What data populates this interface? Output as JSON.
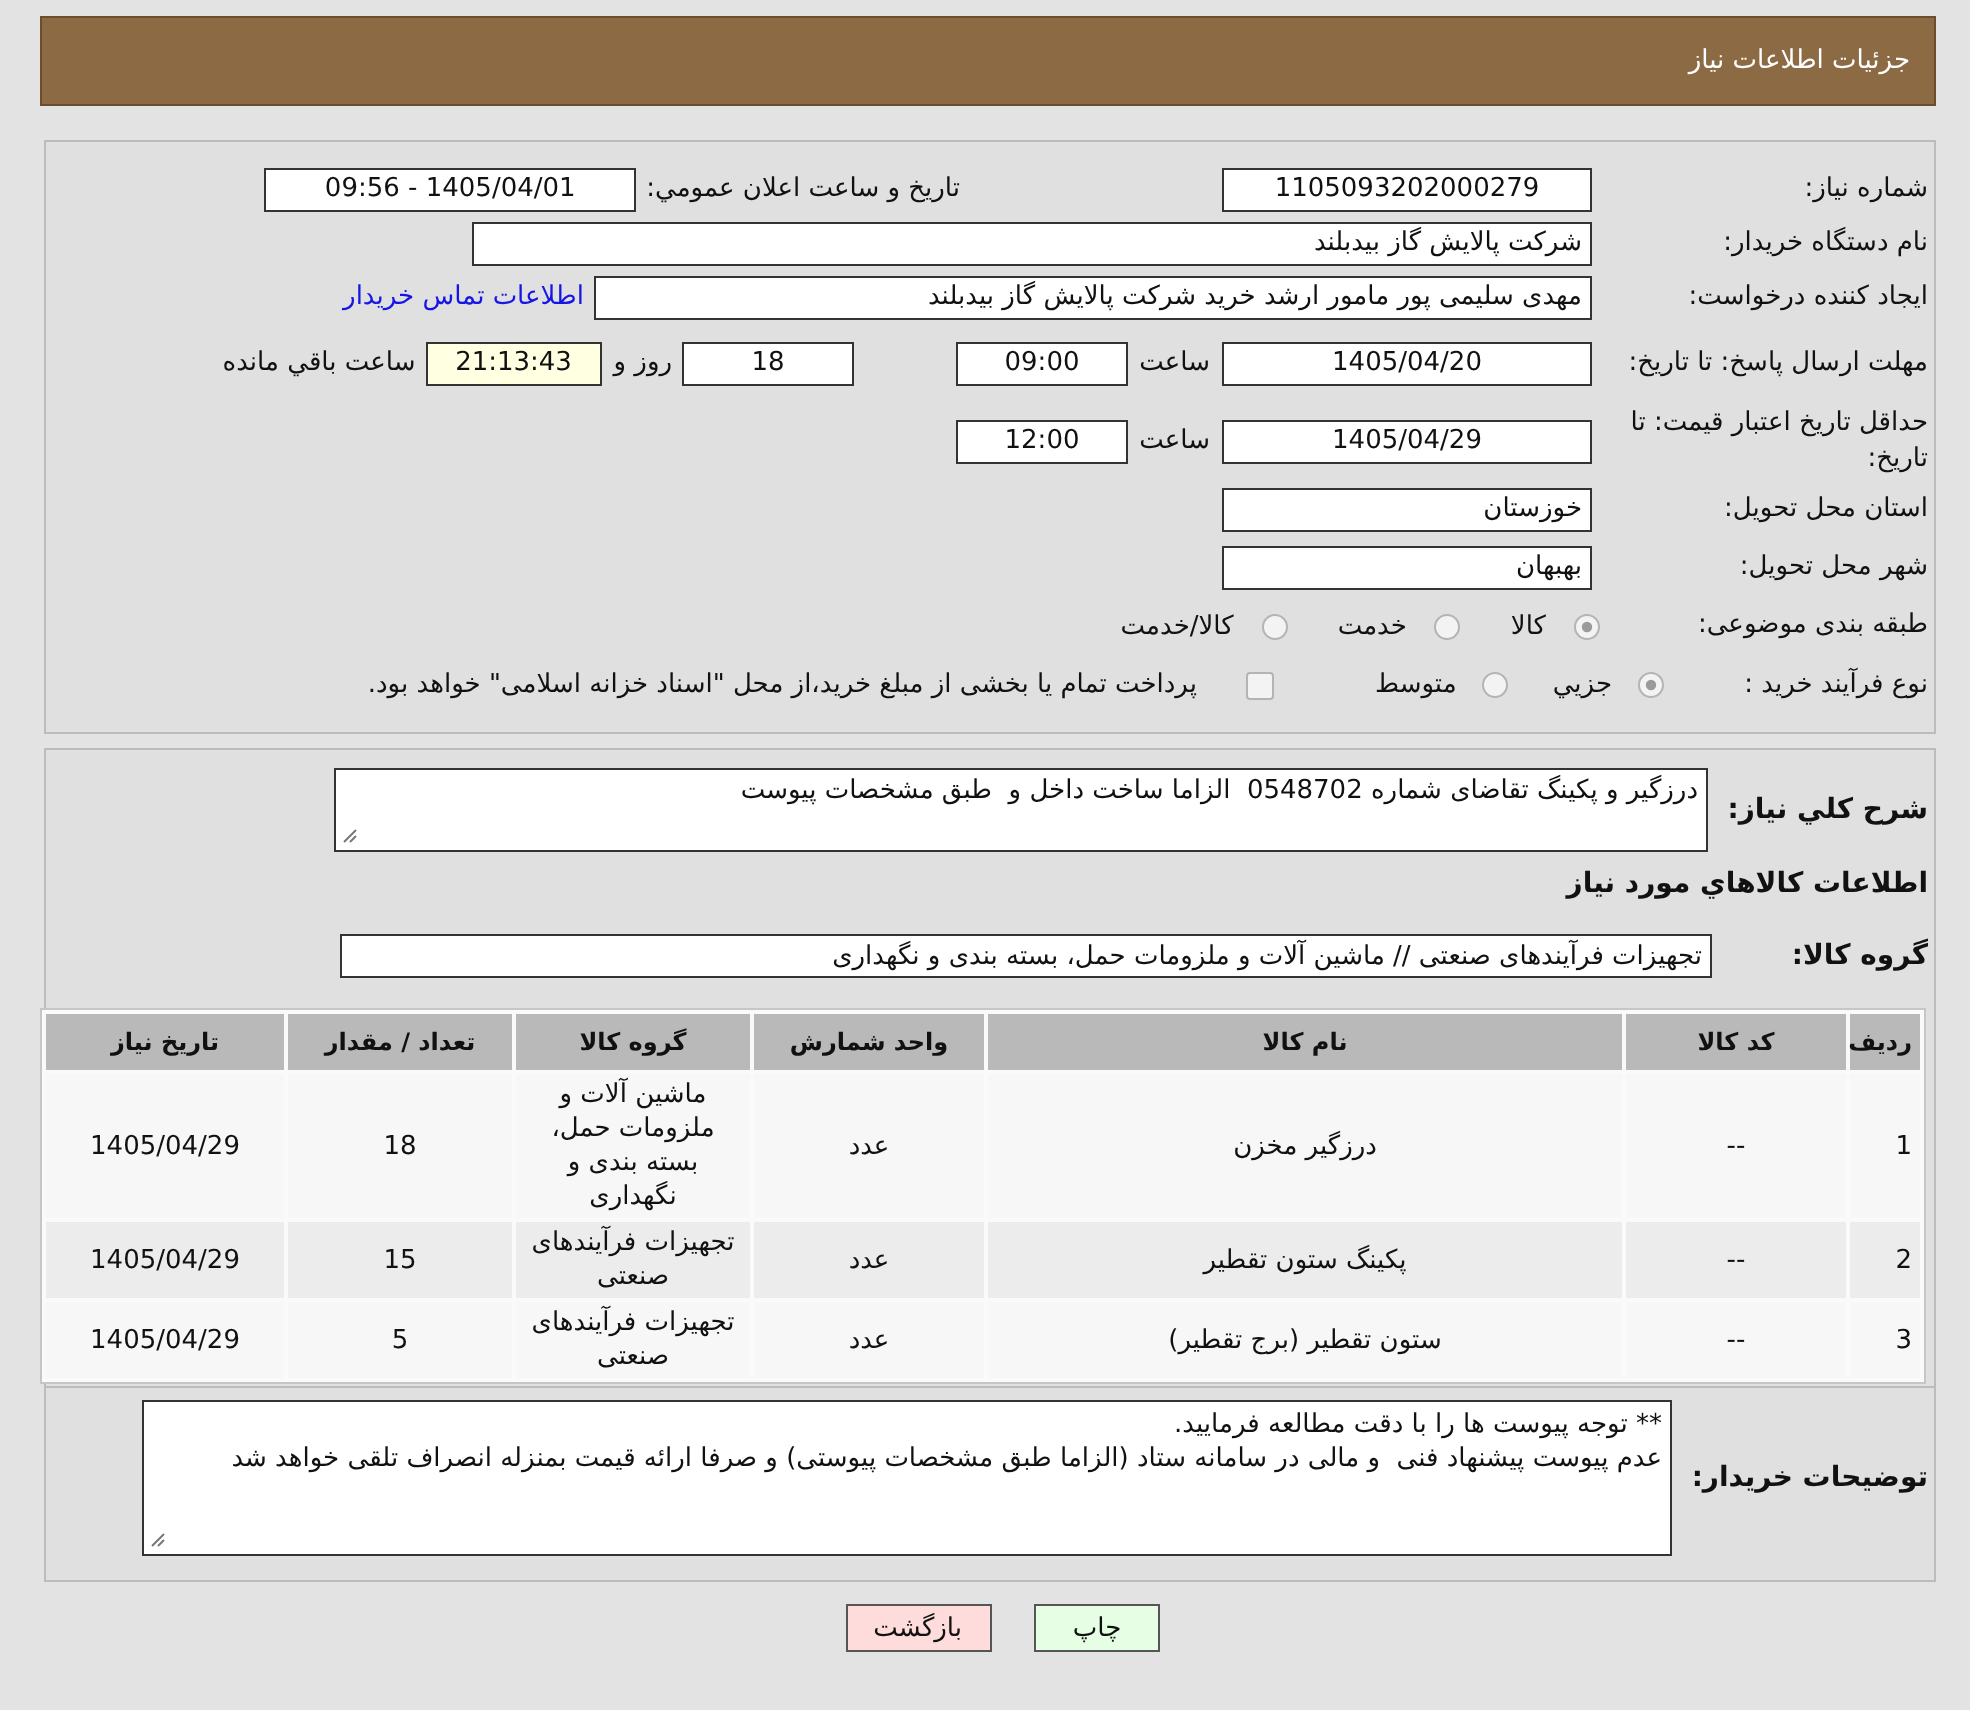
{
  "header": {
    "title": "جزئیات اطلاعات نیاز"
  },
  "details": {
    "need_number": {
      "label": "شماره نیاز:",
      "value": "1105093202000279"
    },
    "announce_date": {
      "label": "تاریخ و ساعت اعلان عمومي:",
      "value": "1405/04/01 - 09:56"
    },
    "buyer_org": {
      "label": "نام دستگاه خريدار:",
      "value": "شرکت پالایش گاز بیدبلند"
    },
    "requester": {
      "label": "ایجاد کننده درخواست:",
      "value": "مهدی سلیمی پور مامور ارشد خرید شرکت پالایش گاز بیدبلند",
      "contact_link": "اطلاعات تماس خریدار"
    },
    "response_deadline": {
      "label": "مهلت ارسال پاسخ: تا تاریخ:",
      "date": "1405/04/20",
      "time_label": "ساعت",
      "time": "09:00",
      "days": "18",
      "days_label": "روز و",
      "remaining": "21:13:43",
      "remaining_label": "ساعت باقي مانده"
    },
    "price_validity": {
      "label": "حداقل تاریخ اعتبار قیمت: تا تاریخ:",
      "date": "1405/04/29",
      "time_label": "ساعت",
      "time": "12:00"
    },
    "province": {
      "label": "استان محل تحویل:",
      "value": "خوزستان"
    },
    "city": {
      "label": "شهر محل تحویل:",
      "value": "بهبهان"
    },
    "category": {
      "label": "طبقه بندی موضوعی:",
      "options": [
        {
          "label": "کالا",
          "selected": true
        },
        {
          "label": "خدمت",
          "selected": false
        },
        {
          "label": "کالا/خدمت",
          "selected": false
        }
      ]
    },
    "process": {
      "label": "نوع فرآیند خرید :",
      "options": [
        {
          "label": "جزيي",
          "selected": true
        },
        {
          "label": "متوسط",
          "selected": false
        }
      ],
      "treasury": {
        "label": "پرداخت تمام یا بخشی از مبلغ خرید،از محل \"اسناد خزانه اسلامی\" خواهد بود.",
        "checked": false
      }
    }
  },
  "description": {
    "label": "شرح کلي نیاز:",
    "value": "درزگیر و پکینگ تقاضای شماره 0548702  الزاما ساخت داخل و  طبق مشخصات پیوست"
  },
  "goods": {
    "title": "اطلاعات کالاهاي مورد نیاز",
    "group_label": "گروه کالا:",
    "group_value": "تجهیزات فرآیندهای صنعتی // ماشین آلات و ملزومات حمل، بسته بندی و نگهداری",
    "table": {
      "columns": [
        "ردیف",
        "کد کالا",
        "نام کالا",
        "واحد شمارش",
        "گروه کالا",
        "تعداد / مقدار",
        "تاریخ نیاز"
      ],
      "rows": [
        {
          "cells": [
            "1",
            "--",
            "درزگیر مخزن",
            "عدد",
            "ماشین آلات و ملزومات حمل، بسته بندی و نگهداری",
            "18",
            "1405/04/29"
          ]
        },
        {
          "cells": [
            "2",
            "--",
            "پکینگ ستون تقطیر",
            "عدد",
            "تجهیزات فرآیندهای صنعتی",
            "15",
            "1405/04/29"
          ]
        },
        {
          "cells": [
            "3",
            "--",
            "ستون تقطیر (برج تقطیر)",
            "عدد",
            "تجهیزات فرآیندهای صنعتی",
            "5",
            "1405/04/29"
          ]
        }
      ]
    }
  },
  "buyer_notes": {
    "label": "توضیحات خریدار:",
    "value": "** توجه پیوست ها را با دقت مطالعه فرمایید.\nعدم پیوست پیشنهاد فنی  و مالی در سامانه ستاد (الزاما طبق مشخصات پیوستی) و صرفا ارائه قیمت بمنزله انصراف تلقی خواهد شد"
  },
  "buttons": [
    {
      "label": "چاپ",
      "kind": "print"
    },
    {
      "label": "بازگشت",
      "kind": "back"
    }
  ]
}
